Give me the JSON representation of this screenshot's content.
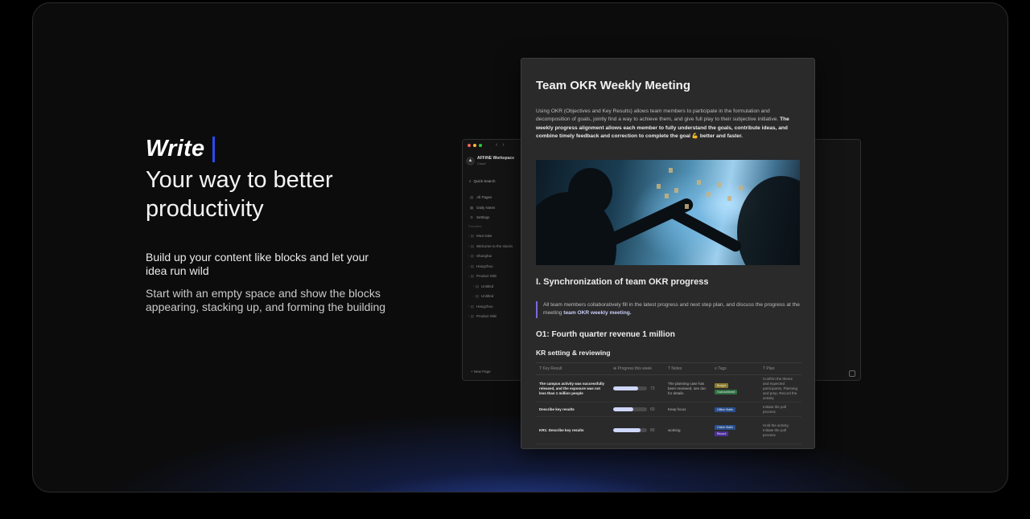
{
  "hero": {
    "write": "Write",
    "tagline_1": "Your way to better",
    "tagline_2": "productivity",
    "para_1": "Build up your content like blocks and let your idea run wild",
    "para_2": "Start with an empty space and show the blocks appearing, stacking up, and forming the building"
  },
  "colors": {
    "accent": "#2b4bf0",
    "glow": "#2c55e0"
  },
  "app": {
    "workspace_name": "AFFiNE Workspace",
    "workspace_sub": "Cloud",
    "quick_search": "Quick Search",
    "nav": [
      {
        "label": "All Pages",
        "icon": "pages-icon"
      },
      {
        "label": "Daily Notes",
        "icon": "calendar-icon"
      },
      {
        "label": "Settings",
        "icon": "gear-icon"
      }
    ],
    "favorites_label": "Favorites",
    "favorites": [
      "Must take",
      "Welcome to the stacks",
      "Shanghai",
      "Hangzhou",
      "Product Wiki",
      "Untitled",
      "Untitled",
      "Hangzhou",
      "Product Wiki"
    ],
    "new_page": "New Page"
  },
  "doc": {
    "title": "Team OKR Weekly Meeting",
    "intro_plain": "Using OKR (Objectives and Key Results) allows team members to participate in the formulation and decomposition of goals, jointly find a way to achieve them, and give full play to their subjective initiative. ",
    "intro_bold": "The weekly progress alignment allows each member to fully understand the goals, contribute ideas, and combine timely feedback and correction to complete the goal 💪 better and faster.",
    "section_1": "I. Synchronization of team OKR progress",
    "quote_plain": "All team members collaboratively fill in the latest progress and next step plan, and discuss the progress at the meeting ",
    "quote_link": "team OKR weekly meeting.",
    "objective": "O1: Fourth quarter revenue 1 million",
    "kr_heading": "KR setting & reviewing",
    "table": {
      "headers": [
        "Key Result",
        "Progress this week",
        "Notes",
        "Tags",
        "Plan"
      ],
      "rows": [
        {
          "key_result": "The campus activity was successfully released, and the exposure was not less than 1 million people",
          "progress": 73,
          "notes": "The planning case has been reviewed, see doc for details",
          "tags": [
            {
              "label": "Budget",
              "bg": "#8a7a2a"
            },
            {
              "label": "Goal achieved",
              "bg": "#2f6f43"
            }
          ],
          "plan": "Confirm the theme and expected participants, Planning and prep, Record the activity"
        },
        {
          "key_result": "Describe key results",
          "progress": 60,
          "notes": "Keep focus",
          "tags": [
            {
              "label": "Offline Staffs",
              "bg": "#2a4f8f"
            }
          ],
          "plan": "Initiate the poll process"
        },
        {
          "key_result": "KR1: Describe key results",
          "progress": 80,
          "notes": "working",
          "tags": [
            {
              "label": "Online Staffs",
              "bg": "#2a4f8f"
            },
            {
              "label": "Record",
              "bg": "#4b2f9a"
            }
          ],
          "plan": "Hold the activity, Initiate the poll process"
        }
      ]
    }
  }
}
